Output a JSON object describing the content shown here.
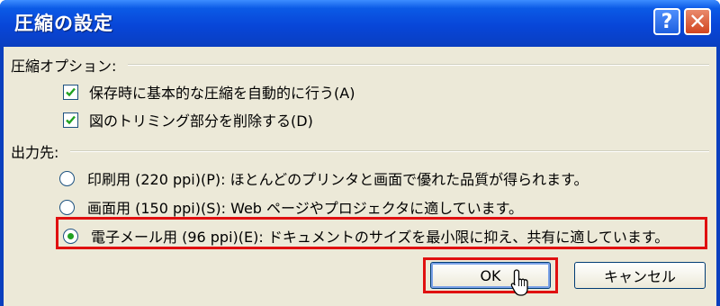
{
  "window": {
    "title": "圧縮の設定",
    "help_label": "?",
    "close_label": "✕"
  },
  "compression_options": {
    "label": "圧縮オプション:",
    "items": [
      {
        "label": "保存時に基本的な圧縮を自動的に行う(A)",
        "checked": true
      },
      {
        "label": "図のトリミング部分を削除する(D)",
        "checked": true
      }
    ]
  },
  "output": {
    "label": "出力先:",
    "items": [
      {
        "label": "印刷用 (220 ppi)(P): ほとんどのプリンタと画面で優れた品質が得られます。",
        "selected": false
      },
      {
        "label": "画面用 (150 ppi)(S): Web ページやプロジェクタに適しています。",
        "selected": false
      },
      {
        "label": "電子メール用 (96 ppi)(E): ドキュメントのサイズを最小限に抑え、共有に適しています。",
        "selected": true
      }
    ]
  },
  "buttons": {
    "ok_label": "OK",
    "cancel_label": "キャンセル"
  },
  "icons": {
    "check": "check-icon",
    "cursor": "mouse-cursor-icon"
  },
  "colors": {
    "titlebar": "#0a5ae6",
    "client_bg": "#ece9d8",
    "highlight": "#e01010",
    "radio_dot": "#21a121",
    "check_mark": "#21a121"
  }
}
